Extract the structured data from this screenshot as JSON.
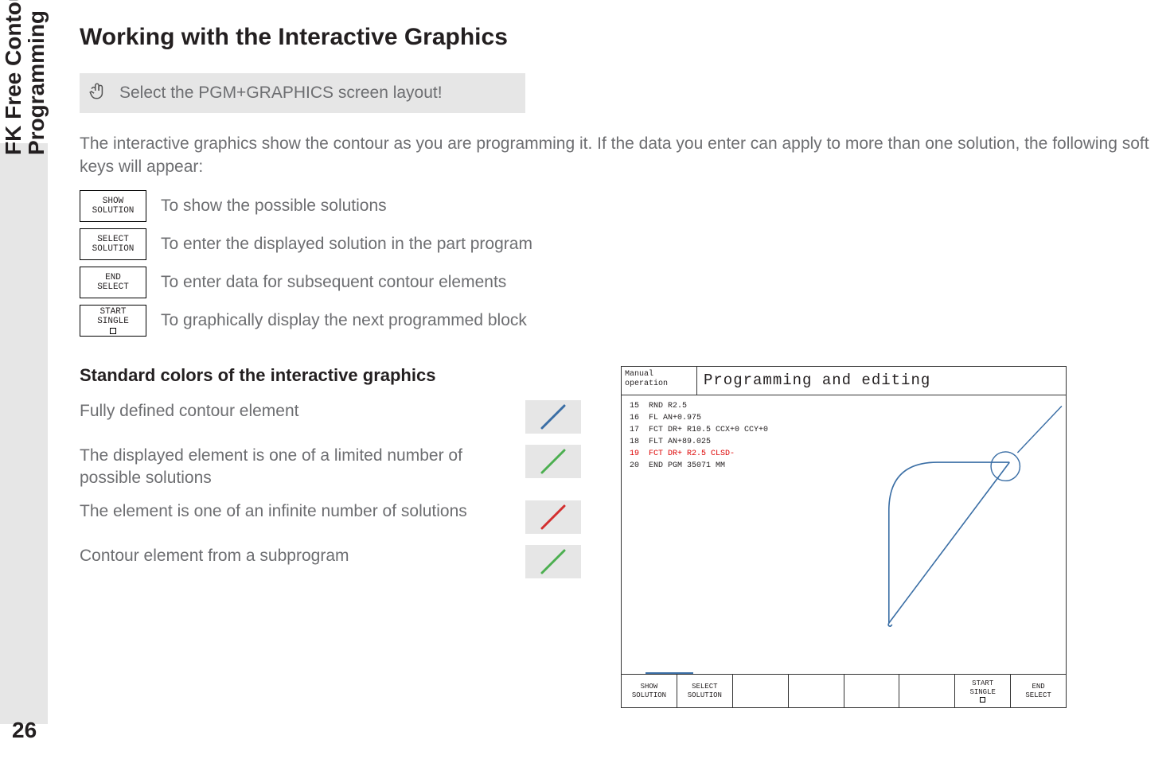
{
  "sidebar": {
    "line1": "FK Free Contour",
    "line2": "Programming"
  },
  "page_number": "26",
  "heading": "Working with the Interactive Graphics",
  "note": "Select the PGM+GRAPHICS screen layout!",
  "intro": "The interactive graphics show the contour as you are programming it. If the data you enter can apply to more than one solution, the following soft keys will appear:",
  "softkeys": [
    {
      "line1": "SHOW",
      "line2": "SOLUTION",
      "desc": "To show the possible solutions"
    },
    {
      "line1": "SELECT",
      "line2": "SOLUTION",
      "desc": "To enter the displayed solution in the part program"
    },
    {
      "line1": "END",
      "line2": "SELECT",
      "desc": "To enter data for subsequent contour elements"
    },
    {
      "line1": "START",
      "line2": "SINGLE",
      "square": true,
      "desc": "To graphically display the next programmed block"
    }
  ],
  "subheading": "Standard colors of the interactive graphics",
  "colors": [
    {
      "desc": "Fully defined contour element",
      "color": "#3a6ea5"
    },
    {
      "desc": "The displayed element is one of a limited number of possible solutions",
      "color": "#4caf50"
    },
    {
      "desc": "The element is one of an infinite number of solutions",
      "color": "#d32f2f"
    },
    {
      "desc": "Contour element from a subprogram",
      "color": "#4caf50"
    }
  ],
  "screenshot": {
    "mode_line1": "Manual",
    "mode_line2": "operation",
    "title": "Programming and editing",
    "code": [
      {
        "n": "15",
        "t": "RND R2.5"
      },
      {
        "n": "16",
        "t": "FL AN+0.975"
      },
      {
        "n": "17",
        "t": "FCT DR+ R10.5 CCX+0 CCY+0"
      },
      {
        "n": "18",
        "t": "FLT AN+89.025"
      },
      {
        "n": "19",
        "t": "FCT DR+ R2.5 CLSD-",
        "hl": true
      },
      {
        "n": "20",
        "t": "END PGM 35071 MM"
      }
    ],
    "footer": [
      {
        "l1": "SHOW",
        "l2": "SOLUTION"
      },
      {
        "l1": "SELECT",
        "l2": "SOLUTION"
      },
      {
        "blank": true
      },
      {
        "blank": true
      },
      {
        "blank": true
      },
      {
        "blank": true
      },
      {
        "l1": "START",
        "l2": "SINGLE",
        "square": true
      },
      {
        "l1": "END",
        "l2": "SELECT"
      }
    ]
  }
}
